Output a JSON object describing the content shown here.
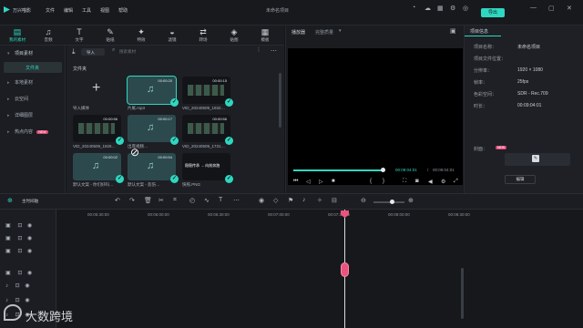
{
  "app": {
    "name": "万兴喵影",
    "title": "未命名项目",
    "export_label": "导出"
  },
  "menu": [
    "文件",
    "编辑",
    "工具",
    "视图",
    "帮助"
  ],
  "toolbar": [
    {
      "label": "我的素材",
      "icon": "▤",
      "name": "my-media"
    },
    {
      "label": "音频",
      "icon": "♫",
      "name": "audio"
    },
    {
      "label": "文字",
      "icon": "T",
      "name": "text"
    },
    {
      "label": "贴纸",
      "icon": "✎",
      "name": "stickers"
    },
    {
      "label": "特效",
      "icon": "✦",
      "name": "effects"
    },
    {
      "label": "滤镜",
      "icon": "◒",
      "name": "filters"
    },
    {
      "label": "转场",
      "icon": "⇄",
      "name": "transitions"
    },
    {
      "label": "贴图",
      "icon": "◈",
      "name": "overlays"
    },
    {
      "label": "模板",
      "icon": "▦",
      "name": "templates"
    }
  ],
  "sidebar": {
    "project_media": "项目素材",
    "folder": "文件夹",
    "items": [
      "本地素材",
      "云空间",
      "详细图层",
      "热点内容"
    ],
    "hot_badge": "NEW"
  },
  "media": {
    "import_label": "导入",
    "search_placeholder": "搜索素材",
    "folder_label": "文件夹",
    "items": [
      {
        "caption": "导入媒体",
        "duration": "",
        "kind": "import"
      },
      {
        "caption": "片尾.mp3",
        "duration": "00:00:20",
        "kind": "audio"
      },
      {
        "caption": "VID_20240509_1932…",
        "duration": "00:00:15",
        "kind": "video"
      },
      {
        "caption": "VID_20240509_1925…",
        "duration": "00:00:56",
        "kind": "video"
      },
      {
        "caption": "出席视频…",
        "duration": "00:00:17",
        "kind": "audio"
      },
      {
        "caption": "VID_20240509_1731…",
        "duration": "00:00:56",
        "kind": "video"
      },
      {
        "caption": "默认文案 - 你们好吗…",
        "duration": "00:00:02",
        "kind": "audio"
      },
      {
        "caption": "默认文案 - 悲伤…",
        "duration": "00:00:54",
        "kind": "audio"
      },
      {
        "caption": "快照.PNG",
        "duration": "",
        "kind": "image"
      }
    ],
    "image_text": "稳稳传承 → 向前奔跑"
  },
  "player": {
    "tabs": [
      "播放器",
      "完整质量"
    ],
    "current_time": "00:09:04:01",
    "total_time": "00:09:04:01"
  },
  "properties": {
    "tab": "项目信息",
    "rows": [
      {
        "label": "项目名称：",
        "value": "未命名项目"
      },
      {
        "label": "项目文件位置：",
        "value": ""
      },
      {
        "label": "分辨率：",
        "value": "1920 × 1080"
      },
      {
        "label": "帧率：",
        "value": "25fps"
      },
      {
        "label": "色彩空间：",
        "value": "SDR - Rec.709"
      },
      {
        "label": "时长：",
        "value": "00:09:04:01"
      }
    ],
    "cover_label": "封面：",
    "cover_badge": "NEW",
    "edit_label": "编辑"
  },
  "timeline": {
    "track_label": "主时间轴",
    "ticks": [
      "00:05:30:00",
      "00:06:00:00",
      "00:06:30:00",
      "00:07:00:00",
      "00:07:30:00",
      "00:08:00:00",
      "00:08:30:00"
    ]
  },
  "watermark": "大数跨境"
}
